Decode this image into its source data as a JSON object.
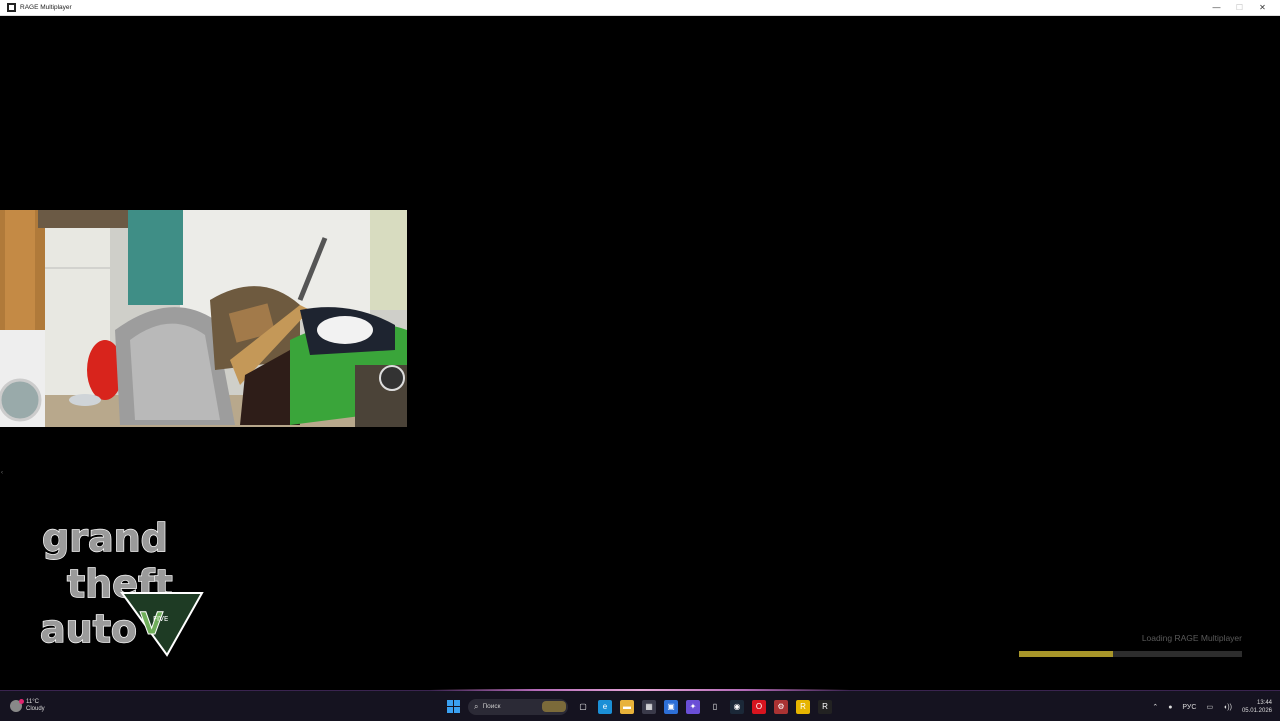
{
  "window": {
    "title": "RAGE Multiplayer",
    "icon": "rage-mp-icon",
    "controls": [
      "—",
      "☐",
      "✕"
    ]
  },
  "webcam": {
    "description_icon": "webcam-feed"
  },
  "logo": {
    "line1": "grand",
    "line2": "theft",
    "line3": "auto",
    "numeral": "V",
    "five": "FIVE"
  },
  "loading": {
    "text": "Loading RAGE Multiplayer",
    "progress": 0.42,
    "track_color": "#2d2d2d",
    "fill_color": "#a8962a"
  },
  "taskbar": {
    "weather": {
      "temp": "11°C",
      "condition": "Cloudy"
    },
    "search_placeholder": "Поиск",
    "apps": [
      {
        "name": "task-view-icon",
        "glyph": "▢",
        "bg": "transparent"
      },
      {
        "name": "edge-icon",
        "glyph": "e",
        "bg": "#1b8fd6"
      },
      {
        "name": "file-explorer-icon",
        "glyph": "▬",
        "bg": "#e8b23a"
      },
      {
        "name": "store-icon",
        "glyph": "▦",
        "bg": "#3a3a4a"
      },
      {
        "name": "app-window-icon",
        "glyph": "▣",
        "bg": "#2d6fd6"
      },
      {
        "name": "copilot-icon",
        "glyph": "✦",
        "bg": "#6a4fd6"
      },
      {
        "name": "file-icon",
        "glyph": "▯",
        "bg": "transparent"
      },
      {
        "name": "steam-icon",
        "glyph": "◉",
        "bg": "#1b2838"
      },
      {
        "name": "opera-icon",
        "glyph": "O",
        "bg": "#d7141f"
      },
      {
        "name": "settings-icon",
        "glyph": "⚙",
        "bg": "#a33"
      },
      {
        "name": "rockstar-icon",
        "glyph": "R",
        "bg": "#e6b400"
      },
      {
        "name": "rage-mp-icon",
        "glyph": "R",
        "bg": "#222"
      }
    ],
    "tray": {
      "chevron": "⌃",
      "mic": "🎙",
      "lang": "РУС",
      "display": "▭",
      "volume": "🔊"
    },
    "clock": {
      "time": "13:44",
      "date": "05.01.2026"
    }
  }
}
